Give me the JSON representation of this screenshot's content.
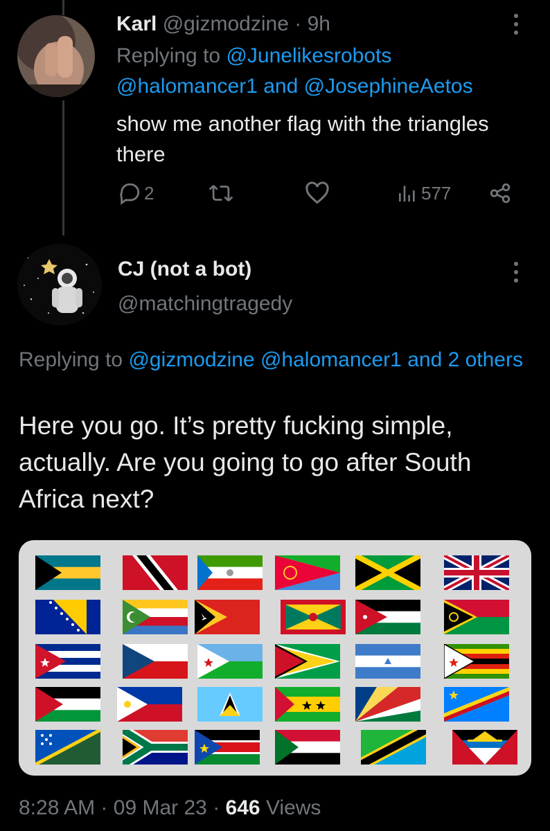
{
  "tweet1": {
    "author_name": "Karl",
    "handle": "@gizmodzine",
    "separator": "·",
    "time": "9h",
    "replying_prefix": "Replying to",
    "replying_line1": "@Junelikesrobots",
    "replying_line2a": "@halomancer1",
    "replying_and": "and",
    "replying_line2b": "@JosephineAetos",
    "body": "show me another flag with the triangles there",
    "reply_count": "2",
    "views": "577"
  },
  "tweet2": {
    "author_name": "CJ (not a bot)",
    "handle": "@matchingtragedy",
    "replying_prefix": "Replying to",
    "replying_users": "@gizmodzine @halomancer1 and 2 others",
    "body": "Here you go. It’s pretty fucking simple, actually. Are you going to go after South Africa next?",
    "timestamp_time": "8:28 AM",
    "timestamp_sep": "·",
    "timestamp_date": "09 Mar 23",
    "views_count": "646",
    "views_label": "Views"
  },
  "flags": [
    "bahamas",
    "trinidad-and-tobago",
    "equatorial-guinea",
    "eritrea",
    "jamaica",
    "united-kingdom",
    "bosnia-and-herzegovina",
    "comoros",
    "east-timor",
    "grenada",
    "jordan",
    "vanuatu",
    "cuba",
    "czech-republic",
    "djibouti",
    "guyana",
    "nicaragua",
    "zimbabwe",
    "palestine",
    "philippines",
    "saint-lucia",
    "sao-tome-and-principe",
    "seychelles",
    "dr-congo",
    "solomon-islands",
    "south-africa",
    "south-sudan",
    "sudan",
    "tanzania",
    "antigua-and-barbuda"
  ],
  "icons": [
    "reply-icon",
    "retweet-icon",
    "like-icon",
    "views-icon",
    "share-icon",
    "more-icon"
  ],
  "colors": {
    "accent": "#1d9bf0",
    "muted": "#71767b",
    "text": "#e7e9ea",
    "background": "#000000"
  }
}
